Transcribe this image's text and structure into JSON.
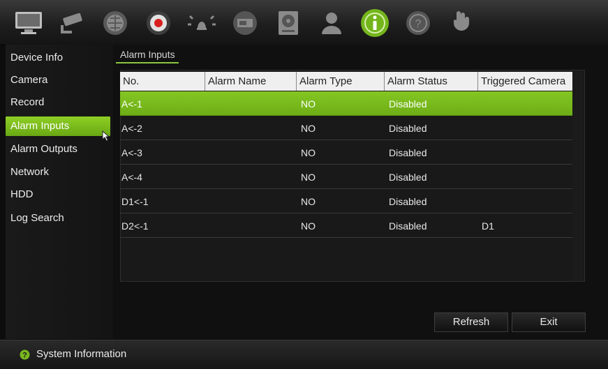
{
  "toolbar": {
    "icons": [
      {
        "name": "monitor-icon"
      },
      {
        "name": "camera-icon"
      },
      {
        "name": "network-globe-icon"
      },
      {
        "name": "record-icon"
      },
      {
        "name": "alarm-icon"
      },
      {
        "name": "device-icon"
      },
      {
        "name": "hdd-icon"
      },
      {
        "name": "user-icon"
      },
      {
        "name": "info-icon",
        "active": true
      },
      {
        "name": "help-icon"
      },
      {
        "name": "shutdown-icon"
      }
    ]
  },
  "sidebar": {
    "items": [
      {
        "label": "Device Info"
      },
      {
        "label": "Camera"
      },
      {
        "label": "Record"
      },
      {
        "label": "Alarm Inputs",
        "active": true
      },
      {
        "label": "Alarm Outputs"
      },
      {
        "label": "Network"
      },
      {
        "label": "HDD"
      },
      {
        "label": "Log Search"
      }
    ]
  },
  "tab": {
    "label": "Alarm Inputs"
  },
  "table": {
    "headers": [
      "No.",
      "Alarm Name",
      "Alarm Type",
      "Alarm Status",
      "Triggered Camera"
    ],
    "rows": [
      {
        "no": "A<-1",
        "name": "",
        "type": "NO",
        "status": "Disabled",
        "camera": ""
      },
      {
        "no": "A<-2",
        "name": "",
        "type": "NO",
        "status": "Disabled",
        "camera": ""
      },
      {
        "no": "A<-3",
        "name": "",
        "type": "NO",
        "status": "Disabled",
        "camera": ""
      },
      {
        "no": "A<-4",
        "name": "",
        "type": "NO",
        "status": "Disabled",
        "camera": ""
      },
      {
        "no": "D1<-1",
        "name": "",
        "type": "NO",
        "status": "Disabled",
        "camera": ""
      },
      {
        "no": "D2<-1",
        "name": "",
        "type": "NO",
        "status": "Disabled",
        "camera": "D1"
      }
    ]
  },
  "buttons": {
    "refresh": "Refresh",
    "exit": "Exit"
  },
  "status": {
    "text": "System Information"
  },
  "colors": {
    "accent": "#7ab81f",
    "background": "#101010"
  }
}
